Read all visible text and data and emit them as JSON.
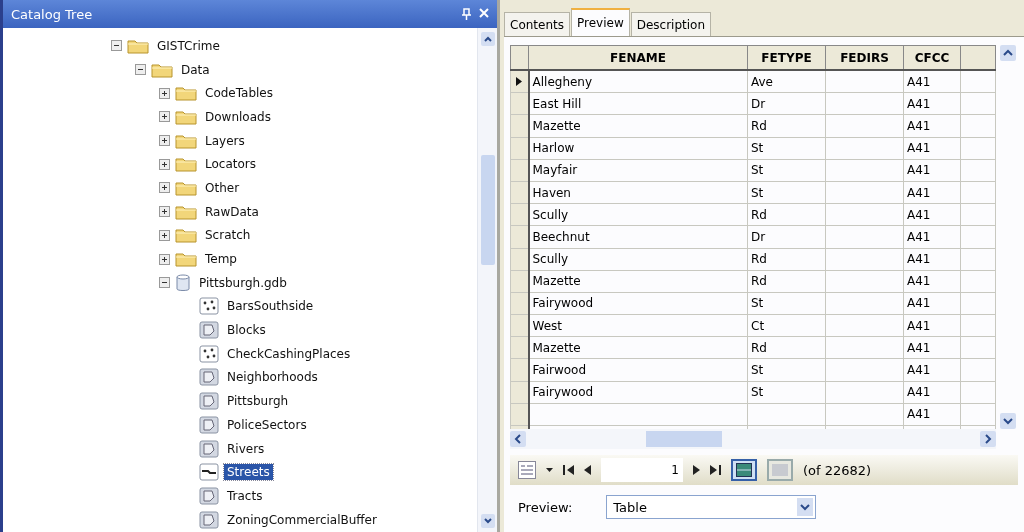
{
  "catalog_tree": {
    "title": "Catalog Tree",
    "items": [
      {
        "label": "GISTCrime",
        "kind": "folder",
        "expanded": true,
        "selected": false,
        "children": [
          {
            "label": "Data",
            "kind": "folder",
            "expanded": true,
            "selected": false,
            "children": [
              {
                "label": "CodeTables",
                "kind": "folder",
                "expanded": false,
                "selected": false
              },
              {
                "label": "Downloads",
                "kind": "folder",
                "expanded": false,
                "selected": false
              },
              {
                "label": "Layers",
                "kind": "folder",
                "expanded": false,
                "selected": false
              },
              {
                "label": "Locators",
                "kind": "folder",
                "expanded": false,
                "selected": false
              },
              {
                "label": "Other",
                "kind": "folder",
                "expanded": false,
                "selected": false
              },
              {
                "label": "RawData",
                "kind": "folder",
                "expanded": false,
                "selected": false
              },
              {
                "label": "Scratch",
                "kind": "folder",
                "expanded": false,
                "selected": false
              },
              {
                "label": "Temp",
                "kind": "folder",
                "expanded": false,
                "selected": false
              },
              {
                "label": "Pittsburgh.gdb",
                "kind": "database",
                "expanded": true,
                "selected": false,
                "children": [
                  {
                    "label": "BarsSouthside",
                    "kind": "point",
                    "selected": false
                  },
                  {
                    "label": "Blocks",
                    "kind": "polygon",
                    "selected": false
                  },
                  {
                    "label": "CheckCashingPlaces",
                    "kind": "point",
                    "selected": false
                  },
                  {
                    "label": "Neighborhoods",
                    "kind": "polygon",
                    "selected": false
                  },
                  {
                    "label": "Pittsburgh",
                    "kind": "polygon",
                    "selected": false
                  },
                  {
                    "label": "PoliceSectors",
                    "kind": "polygon",
                    "selected": false
                  },
                  {
                    "label": "Rivers",
                    "kind": "polygon",
                    "selected": false
                  },
                  {
                    "label": "Streets",
                    "kind": "line",
                    "selected": true
                  },
                  {
                    "label": "Tracts",
                    "kind": "polygon",
                    "selected": false
                  },
                  {
                    "label": "ZoningCommercialBuffer",
                    "kind": "polygon",
                    "selected": false
                  }
                ]
              }
            ]
          }
        ]
      }
    ]
  },
  "tabs": [
    {
      "label": "Contents",
      "selected": false
    },
    {
      "label": "Preview",
      "selected": true
    },
    {
      "label": "Description",
      "selected": false
    }
  ],
  "table": {
    "columns": [
      "FENAME",
      "FETYPE",
      "FEDIRS",
      "CFCC"
    ],
    "rows": [
      {
        "current": true,
        "cells": [
          "Allegheny",
          "Ave",
          null,
          "A41"
        ]
      },
      {
        "current": false,
        "cells": [
          "East Hill",
          "Dr",
          null,
          "A41"
        ]
      },
      {
        "current": false,
        "cells": [
          "Mazette",
          "Rd",
          null,
          "A41"
        ]
      },
      {
        "current": false,
        "cells": [
          "Harlow",
          "St",
          null,
          "A41"
        ]
      },
      {
        "current": false,
        "cells": [
          "Mayfair",
          "St",
          null,
          "A41"
        ]
      },
      {
        "current": false,
        "cells": [
          "Haven",
          "St",
          null,
          "A41"
        ]
      },
      {
        "current": false,
        "cells": [
          "Scully",
          "Rd",
          null,
          "A41"
        ]
      },
      {
        "current": false,
        "cells": [
          "Beechnut",
          "Dr",
          null,
          "A41"
        ]
      },
      {
        "current": false,
        "cells": [
          "Scully",
          "Rd",
          null,
          "A41"
        ]
      },
      {
        "current": false,
        "cells": [
          "Mazette",
          "Rd",
          null,
          "A41"
        ]
      },
      {
        "current": false,
        "cells": [
          "Fairywood",
          "St",
          null,
          "A41"
        ]
      },
      {
        "current": false,
        "cells": [
          "West",
          "Ct",
          null,
          "A41"
        ]
      },
      {
        "current": false,
        "cells": [
          "Mazette",
          "Rd",
          null,
          "A41"
        ]
      },
      {
        "current": false,
        "cells": [
          "Fairwood",
          "St",
          null,
          "A41"
        ]
      },
      {
        "current": false,
        "cells": [
          "Fairywood",
          "St",
          null,
          "A41"
        ]
      },
      {
        "current": false,
        "cells": [
          null,
          null,
          null,
          "A41"
        ]
      }
    ]
  },
  "navigator": {
    "record": "1",
    "count": "(of 22682)",
    "show_all_selected": true
  },
  "preview": {
    "label": "Preview:",
    "value": "Table"
  }
}
